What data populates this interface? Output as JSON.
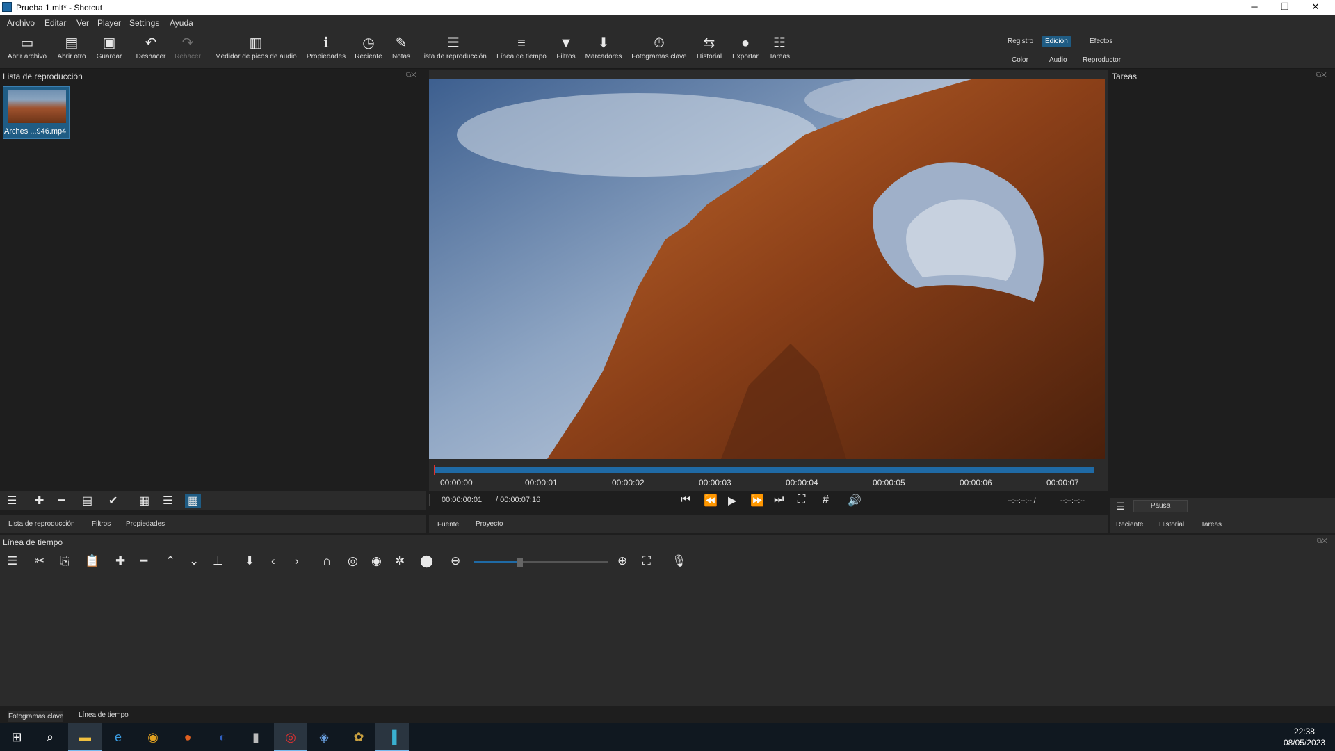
{
  "window": {
    "title": "Prueba 1.mlt* - Shotcut",
    "minimize": "─",
    "maximize": "❐",
    "close": "✕"
  },
  "menu": [
    "Archivo",
    "Editar",
    "Ver",
    "Player",
    "Settings",
    "Ayuda"
  ],
  "toolbar": {
    "items": [
      {
        "label": "Abrir archivo",
        "icon": "folder-open-icon"
      },
      {
        "label": "Abrir otro",
        "icon": "open-other-icon"
      },
      {
        "label": "Guardar",
        "icon": "save-icon"
      },
      {
        "label": "Deshacer",
        "icon": "undo-icon"
      },
      {
        "label": "Rehacer",
        "icon": "redo-icon",
        "disabled": true
      },
      {
        "label": "Medidor de picos de audio",
        "icon": "audio-meter-icon"
      },
      {
        "label": "Propiedades",
        "icon": "info-icon"
      },
      {
        "label": "Reciente",
        "icon": "clock-icon"
      },
      {
        "label": "Notas",
        "icon": "notes-icon"
      },
      {
        "label": "Lista de reproducción",
        "icon": "playlist-icon"
      },
      {
        "label": "Línea de tiempo",
        "icon": "timeline-icon"
      },
      {
        "label": "Filtros",
        "icon": "filter-icon"
      },
      {
        "label": "Marcadores",
        "icon": "marker-icon"
      },
      {
        "label": "Fotogramas clave",
        "icon": "keyframes-icon"
      },
      {
        "label": "Historial",
        "icon": "history-icon"
      },
      {
        "label": "Exportar",
        "icon": "export-icon"
      },
      {
        "label": "Tareas",
        "icon": "jobs-icon"
      }
    ],
    "layouts_top": [
      "Registro",
      "Edición",
      "Efectos"
    ],
    "layouts_bottom": [
      "Color",
      "Audio",
      "Reproductor"
    ],
    "active_layout": "Edición"
  },
  "playlist_panel": {
    "title": "Lista de reproducción",
    "clip_label": "Arches ...946.mp4",
    "tabs": [
      "Lista de reproducción",
      "Filtros",
      "Propiedades"
    ]
  },
  "jobs_panel": {
    "title": "Tareas",
    "pause_label": "Pausa",
    "tabs": [
      "Reciente",
      "Historial",
      "Tareas"
    ]
  },
  "player": {
    "ruler_labels": [
      "00:00:00",
      "00:00:01",
      "00:00:02",
      "00:00:03",
      "00:00:04",
      "00:00:05",
      "00:00:06",
      "00:00:07"
    ],
    "position": "00:00:00:01",
    "duration": "/ 00:00:07:16",
    "in_point": "--:--:--:-- /",
    "out_point": "--:--:--:--",
    "tabs": [
      "Fuente",
      "Proyecto"
    ]
  },
  "timeline_panel": {
    "title": "Línea de tiempo",
    "tabs": [
      "Fotogramas clave",
      "Línea de tiempo"
    ]
  },
  "taskbar": {
    "time": "22:38",
    "date": "08/05/2023"
  }
}
